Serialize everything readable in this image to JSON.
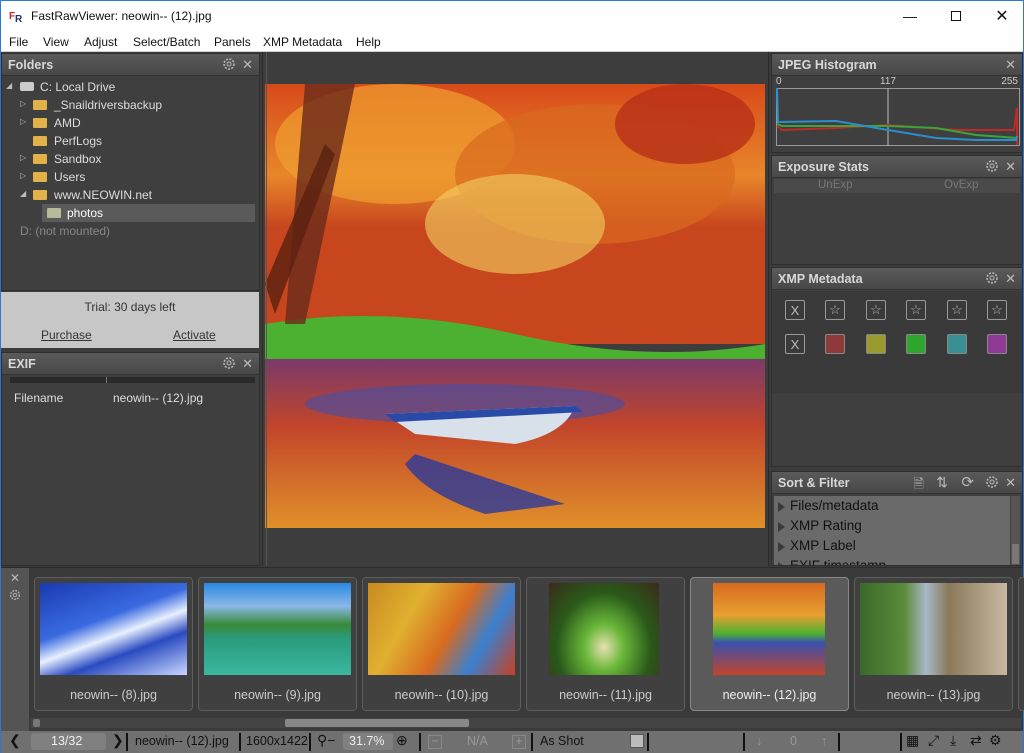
{
  "window": {
    "title": "FastRawViewer: neowin-- (12).jpg",
    "minimize_icon": "minimize-icon",
    "maximize_icon": "maximize-icon",
    "close_icon": "close-icon"
  },
  "menu": [
    "File",
    "View",
    "Adjust",
    "Select/Batch",
    "Panels",
    "XMP Metadata",
    "Help"
  ],
  "folders": {
    "title": "Folders",
    "items": [
      {
        "label": "C: Local Drive",
        "type": "drive",
        "expanded": true
      },
      {
        "label": "_Snaildriversbackup",
        "type": "folder",
        "expandable": true
      },
      {
        "label": "AMD",
        "type": "folder",
        "expandable": true
      },
      {
        "label": "PerfLogs",
        "type": "folder",
        "expandable": false
      },
      {
        "label": "Sandbox",
        "type": "folder",
        "expandable": true
      },
      {
        "label": "Users",
        "type": "folder",
        "expandable": true
      },
      {
        "label": "www.NEOWIN.net",
        "type": "folder",
        "expanded": true
      },
      {
        "label": "photos",
        "type": "folder",
        "selected": true
      },
      {
        "label": "D: (not mounted)",
        "type": "drive-unmounted"
      }
    ]
  },
  "trial": {
    "text": "Trial: 30 days left",
    "purchase": "Purchase",
    "activate": "Activate"
  },
  "exif": {
    "title": "EXIF",
    "rows": [
      {
        "key": "Filename",
        "value": "neowin-- (12).jpg"
      }
    ]
  },
  "histogram": {
    "title": "JPEG Histogram",
    "labels": [
      "0",
      "117",
      "255"
    ],
    "colors": {
      "red": "#c0282a",
      "green": "#3aa53a",
      "blue": "#2a8fd0"
    }
  },
  "exposure": {
    "title": "Exposure Stats",
    "columns": [
      "UnExp",
      "OvExp"
    ]
  },
  "xmp": {
    "title": "XMP Metadata",
    "rating_clear": "X",
    "stars": 5,
    "label_clear": "X",
    "label_colors": [
      "#8f3a3a",
      "#9a9a2e",
      "#2ea62e",
      "#3a8f92",
      "#8f3a92"
    ]
  },
  "sortfilter": {
    "title": "Sort & Filter",
    "items": [
      "Files/metadata",
      "XMP Rating",
      "XMP Label",
      "EXIF timestamp"
    ]
  },
  "filmstrip": {
    "thumbs": [
      {
        "caption": "neowin-- (8).jpg",
        "selected": false
      },
      {
        "caption": "neowin-- (9).jpg",
        "selected": false
      },
      {
        "caption": "neowin-- (10).jpg",
        "selected": false
      },
      {
        "caption": "neowin-- (11).jpg",
        "selected": false
      },
      {
        "caption": "neowin-- (12).jpg",
        "selected": true
      },
      {
        "caption": "neowin-- (13).jpg",
        "selected": false
      }
    ]
  },
  "status": {
    "position": "13/32",
    "filename": "neowin-- (12).jpg",
    "dimensions": "1600x1422",
    "zoom": "31.7%",
    "exposure": "N/A",
    "white_balance": "As Shot",
    "counter": "0"
  }
}
